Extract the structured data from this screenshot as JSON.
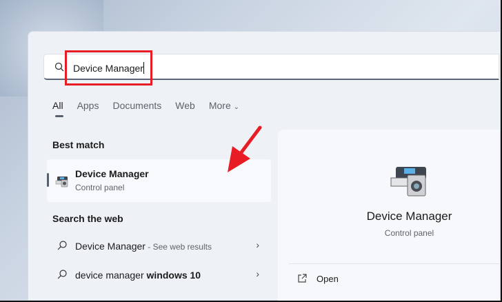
{
  "search": {
    "value": "Device Manager"
  },
  "tabs": [
    {
      "label": "All"
    },
    {
      "label": "Apps"
    },
    {
      "label": "Documents"
    },
    {
      "label": "Web"
    },
    {
      "label": "More"
    }
  ],
  "best_match": {
    "heading": "Best match",
    "title": "Device Manager",
    "subtitle": "Control panel"
  },
  "web": {
    "heading": "Search the web",
    "items": [
      {
        "query": "Device Manager",
        "suffix": " - See web results"
      },
      {
        "query": "device manager ",
        "bold": "windows 10"
      }
    ]
  },
  "detail": {
    "title": "Device Manager",
    "subtitle": "Control panel",
    "actions": [
      {
        "label": "Open"
      }
    ]
  },
  "colors": {
    "highlight": "#e81c24"
  }
}
